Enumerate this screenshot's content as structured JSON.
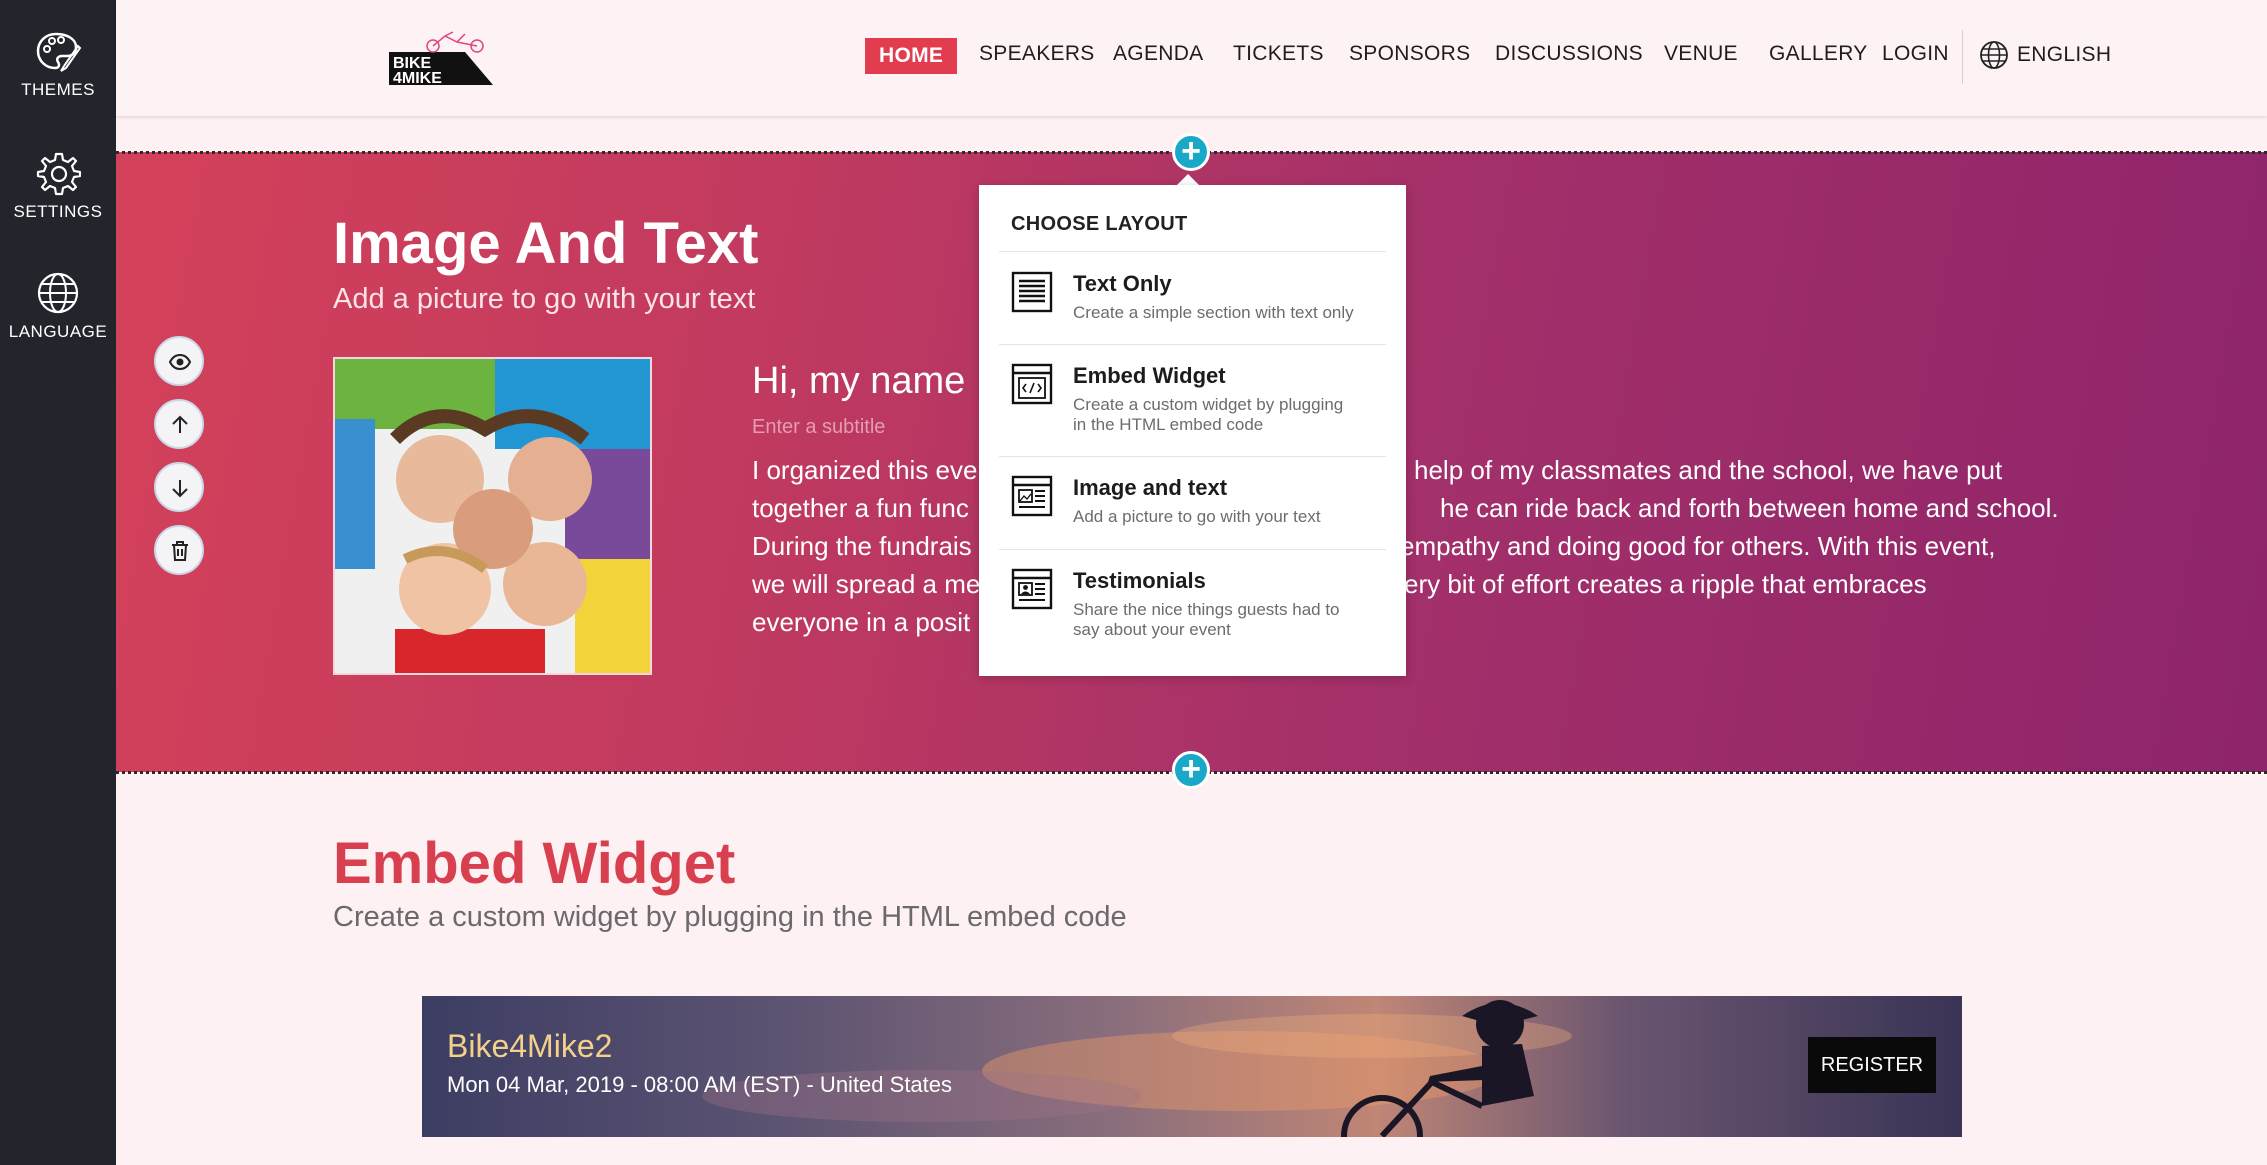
{
  "sidebar": {
    "items": [
      {
        "label": "THEMES",
        "icon": "palette-icon"
      },
      {
        "label": "SETTINGS",
        "icon": "gear-icon"
      },
      {
        "label": "LANGUAGE",
        "icon": "globe-icon"
      }
    ]
  },
  "header": {
    "logo_text_top": "BIKE",
    "logo_text_bottom": "4MIKE",
    "nav": [
      "HOME",
      "SPEAKERS",
      "AGENDA",
      "TICKETS",
      "SPONSORS",
      "DISCUSSIONS",
      "VENUE",
      "GALLERY",
      "LOGIN"
    ],
    "active": "HOME",
    "language": "ENGLISH"
  },
  "hero": {
    "title": "Image And Text",
    "subtitle": "Add a picture to go with your text",
    "heading": "Hi, my name",
    "subtitle_placeholder": "Enter a subtitle",
    "body_lines": [
      "I organized this eve",
      "together a fun func",
      "During the fundrais",
      "we will spread a me",
      "everyone in a posit"
    ],
    "body_lines_right": [
      "help of my classmates and the school, we have put",
      "he can ride back and forth between home and school.",
      "empathy and doing good for others. With this event,",
      "ery bit of effort creates a ripple that embraces"
    ],
    "controls": [
      "eye-icon",
      "arrow-up-icon",
      "arrow-down-icon",
      "trash-icon"
    ]
  },
  "layout_popup": {
    "title": "CHOOSE LAYOUT",
    "options": [
      {
        "title": "Text Only",
        "desc": [
          "Create a simple section with text only"
        ]
      },
      {
        "title": "Embed Widget",
        "desc": [
          "Create a custom widget by plugging",
          "in the HTML embed code"
        ]
      },
      {
        "title": "Image and text",
        "desc": [
          "Add a picture to go with your text"
        ]
      },
      {
        "title": "Testimonials",
        "desc": [
          "Share the nice things guests had to",
          "say about your event"
        ]
      }
    ]
  },
  "embed": {
    "title": "Embed Widget",
    "subtitle": "Create a custom widget by plugging in the HTML embed code",
    "event_name": "Bike4Mike2",
    "event_date": "Mon 04 Mar, 2019 - 08:00 AM (EST) - United States",
    "register_label": "REGISTER"
  },
  "colors": {
    "accent": "#e23c4f",
    "plus": "#19a8c8",
    "rail": "#22252b",
    "embed_title": "#d8404f"
  }
}
